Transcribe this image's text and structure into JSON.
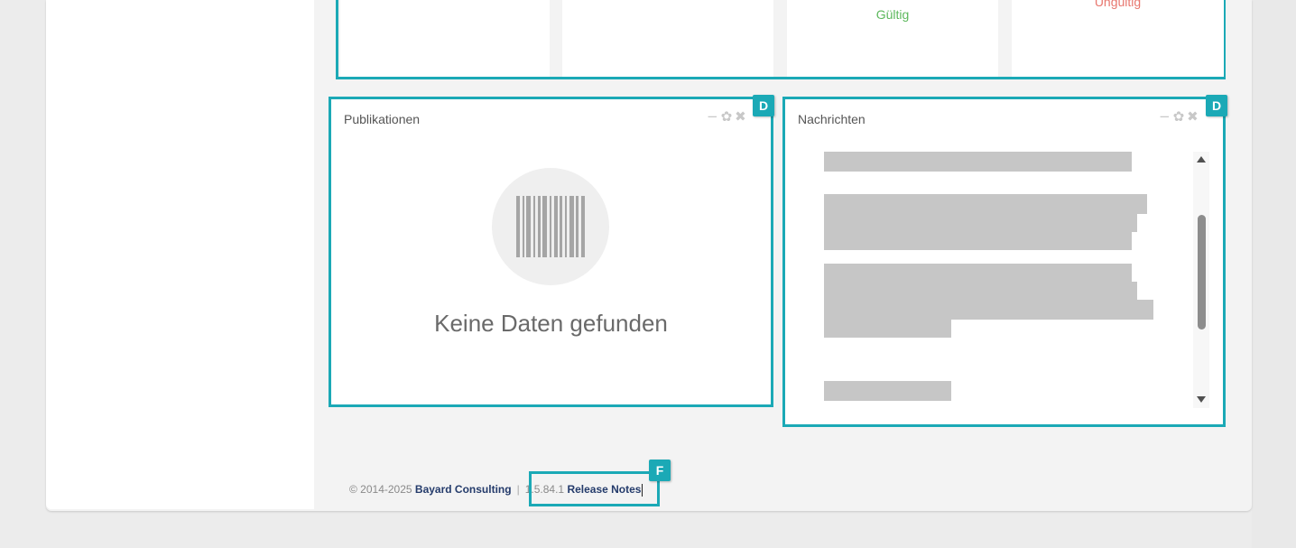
{
  "validity_row": {
    "valid_label": "Gültig",
    "invalid_label": "Ungültig",
    "colors": {
      "valid": "#5cb85c",
      "invalid": "#e8776f"
    }
  },
  "widgets": {
    "publications": {
      "title": "Publikationen",
      "badge": "D",
      "controls": [
        "minimize-icon",
        "gear-icon",
        "close-icon"
      ],
      "empty_icon": "barcode-icon",
      "empty_text": "Keine Daten gefunden"
    },
    "news": {
      "title": "Nachrichten",
      "badge": "D",
      "controls": [
        "minimize-icon",
        "gear-icon",
        "close-icon"
      ]
    }
  },
  "footer": {
    "copyright": "© 2014-2025",
    "company": "Bayard Consulting",
    "separator": "|",
    "version": "1.5.84.1",
    "release_notes": "Release Notes",
    "badge": "F"
  },
  "colors": {
    "accent": "#1ba9b6",
    "brand_text": "#243b6b"
  }
}
